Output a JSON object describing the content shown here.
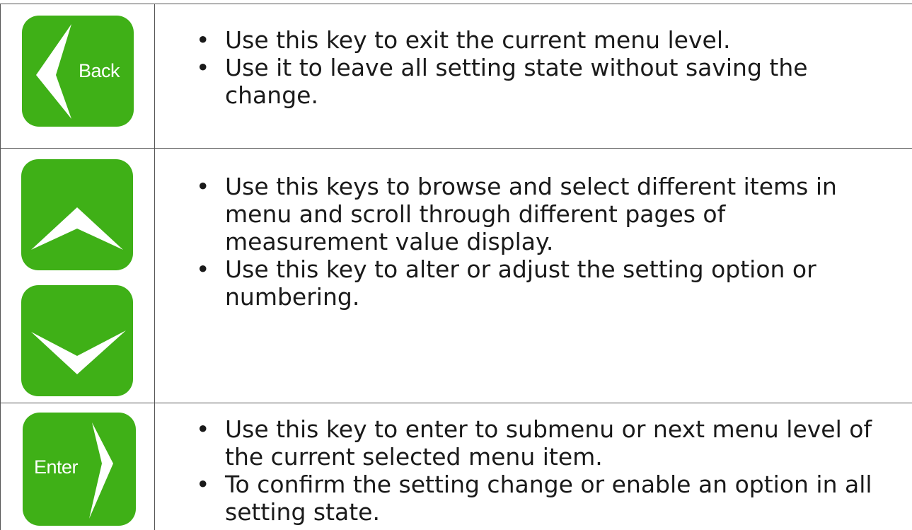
{
  "colors": {
    "key_green": "#3fb017",
    "icon_white": "#ffffff",
    "border": "#555555"
  },
  "rows": [
    {
      "keys": [
        {
          "icon": "back-arrow-icon",
          "label": "Back"
        }
      ],
      "bullets": [
        "Use this key to exit the current menu level.",
        "Use it to leave all setting state without saving the change."
      ]
    },
    {
      "keys": [
        {
          "icon": "up-arrow-icon",
          "label": ""
        },
        {
          "icon": "down-arrow-icon",
          "label": ""
        }
      ],
      "bullets": [
        "Use this keys to browse and select different items in menu and scroll through different pages of measurement value display.",
        "Use this key to alter or adjust the setting option or numbering."
      ]
    },
    {
      "keys": [
        {
          "icon": "enter-arrow-icon",
          "label": "Enter"
        }
      ],
      "bullets": [
        "Use this key to enter to submenu or next menu level of the current selected menu item.",
        "To confirm the setting change or enable an option in all setting state."
      ]
    }
  ]
}
